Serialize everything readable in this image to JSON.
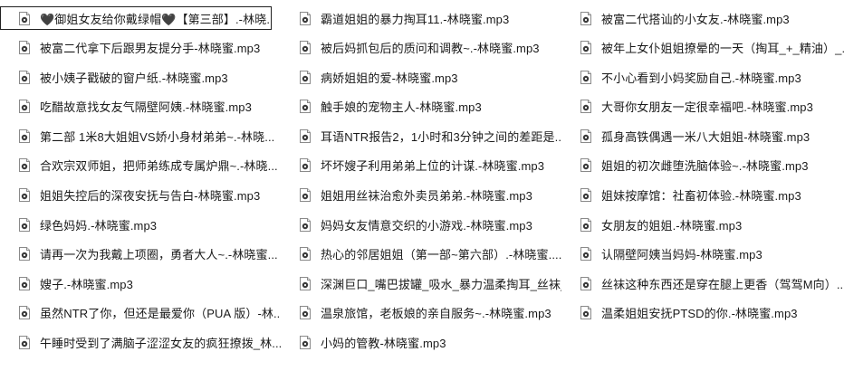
{
  "files": [
    {
      "name": "🖤御姐女友给你戴绿帽🖤【第三部】.-林晓...",
      "selected": true
    },
    {
      "name": "被富二代拿下后跟男友提分手-林晓蜜.mp3"
    },
    {
      "name": "被小姨子戳破的窗户纸.-林晓蜜.mp3"
    },
    {
      "name": "吃醋故意找女友气隔壁阿姨.-林晓蜜.mp3"
    },
    {
      "name": "第二部 1米8大姐姐VS娇小身材弟弟~.-林晓..."
    },
    {
      "name": "合欢宗双师姐，把师弟练成专属炉鼎~.-林晓..."
    },
    {
      "name": "姐姐失控后的深夜安抚与告白-林晓蜜.mp3"
    },
    {
      "name": "绿色妈妈.-林晓蜜.mp3"
    },
    {
      "name": "请再一次为我戴上项圈，勇者大人~.-林晓蜜..."
    },
    {
      "name": "嫂子.-林晓蜜.mp3"
    },
    {
      "name": "虽然NTR了你，但还是最爱你（PUA 版）-林..."
    },
    {
      "name": "午睡时受到了满脑子涩涩女友的疯狂撩拨_林..."
    },
    {
      "name": "霸道姐姐的暴力掏耳11.-林晓蜜.mp3"
    },
    {
      "name": "被后妈抓包后的质问和调教~.-林晓蜜.mp3"
    },
    {
      "name": "病娇姐姐的爱-林晓蜜.mp3"
    },
    {
      "name": "触手娘的宠物主人-林晓蜜.mp3"
    },
    {
      "name": "耳语NTR报告2，1小时和3分钟之间的差距是..."
    },
    {
      "name": "坏坏嫂子利用弟弟上位的计谋.-林晓蜜.mp3"
    },
    {
      "name": "姐姐用丝袜治愈外卖员弟弟.-林晓蜜.mp3"
    },
    {
      "name": "妈妈女友情意交织的小游戏.-林晓蜜.mp3"
    },
    {
      "name": "热心的邻居姐姐（第一部~第六部）.-林晓蜜...."
    },
    {
      "name": "深渊巨口_嘴巴拔罐_吸水_暴力温柔掏耳_丝袜_..."
    },
    {
      "name": "温泉旅馆，老板娘的亲自服务~.-林晓蜜.mp3"
    },
    {
      "name": "小妈的管教-林晓蜜.mp3"
    },
    {
      "name": "被富二代搭讪的小女友.-林晓蜜.mp3"
    },
    {
      "name": "被年上女仆姐姐撩晕的一天（掏耳_+_精油）_..."
    },
    {
      "name": "不小心看到小妈奖励自己.-林晓蜜.mp3"
    },
    {
      "name": "大哥你女朋友一定很幸福吧.-林晓蜜.mp3"
    },
    {
      "name": "孤身高铁偶遇一米八大姐姐-林晓蜜.mp3"
    },
    {
      "name": "姐姐的初次雌堕洗脑体验~.-林晓蜜.mp3"
    },
    {
      "name": "姐妹按摩馆：社畜初体验.-林晓蜜.mp3"
    },
    {
      "name": "女朋友的姐姐.-林晓蜜.mp3"
    },
    {
      "name": "认隔壁阿姨当妈妈-林晓蜜.mp3"
    },
    {
      "name": "丝袜这种东西还是穿在腿上更香（驾驾M向）..."
    },
    {
      "name": "温柔姐姐安抚PTSD的你.-林晓蜜.mp3"
    }
  ],
  "icon": "audio-file-icon"
}
